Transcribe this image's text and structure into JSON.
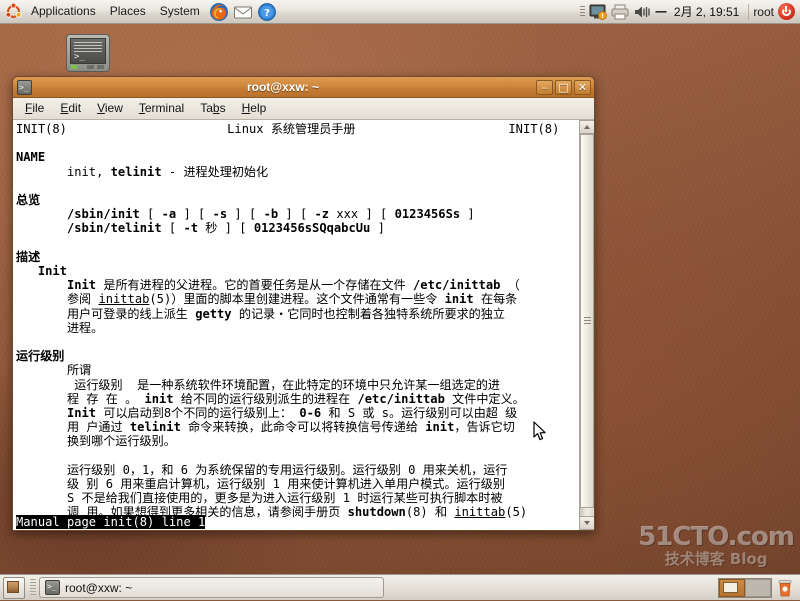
{
  "top_panel": {
    "logo_icon": "ubuntu-logo-icon",
    "menus": [
      {
        "label": "Applications"
      },
      {
        "label": "Places"
      },
      {
        "label": "System"
      }
    ],
    "launchers": [
      {
        "icon": "firefox-icon",
        "title": "Firefox Web Browser"
      },
      {
        "icon": "mail-icon",
        "title": "Evolution Mail"
      },
      {
        "icon": "help-icon",
        "title": "Help"
      }
    ],
    "tray": [
      {
        "icon": "panel-grip-icon"
      },
      {
        "icon": "network-monitor-icon"
      },
      {
        "icon": "printer-icon"
      },
      {
        "icon": "volume-icon"
      },
      {
        "icon": "input-method-icon",
        "label": "—"
      }
    ],
    "clock": "2月 2, 19:51",
    "user": "root",
    "power_icon": "power-icon"
  },
  "desktop": {
    "icons": [
      {
        "icon": "terminal-icon",
        "label": ""
      }
    ],
    "watermark_main": "51CTO.com",
    "watermark_sub": "技术博客  Blog"
  },
  "terminal_window": {
    "title": "root@xxw: ~",
    "title_icon": "terminal-icon",
    "window_buttons": [
      {
        "name": "minimize",
        "glyph": "–"
      },
      {
        "name": "maximize",
        "glyph": "□"
      },
      {
        "name": "close",
        "glyph": "✕"
      }
    ],
    "menus": [
      {
        "label": "File",
        "mnemonic": "F"
      },
      {
        "label": "Edit",
        "mnemonic": "E"
      },
      {
        "label": "View",
        "mnemonic": "V"
      },
      {
        "label": "Terminal",
        "mnemonic": "T"
      },
      {
        "label": "Tabs",
        "mnemonic": "b"
      },
      {
        "label": "Help",
        "mnemonic": "H"
      }
    ],
    "content": {
      "header_left": "INIT(8)",
      "header_center": "Linux 系统管理员手册",
      "header_right": "INIT(8)",
      "sections": [
        {
          "heading": "NAME",
          "lines": [
            "       init, telinit - 进程处理初始化"
          ]
        },
        {
          "heading": "总览",
          "lines": [
            "       /sbin/init [ -a ] [ -s ] [ -b ] [ -z xxx ] [ 0123456Ss ]",
            "       /sbin/telinit [ -t 秒 ] [ 0123456sSQqabcUu ]"
          ]
        },
        {
          "heading": "描述",
          "lines": [
            "   Init",
            "       Init 是所有进程的父进程。它的首要任务是从一个存储在文件 /etc/inittab （",
            "       参阅 inittab(5)）里面的脚本里创建进程。这个文件通常有一些令 init 在每条",
            "       用户可登录的线上派生 getty 的记录・它同时也控制着各独特系统所要求的独立",
            "       进程。"
          ]
        },
        {
          "heading": "运行级别",
          "lines": [
            "       所谓",
            "        运行级别  是一种系统软件环境配置，在此特定的环境中只允许某一组选定的进",
            "       程 存 在 。 init 给不同的运行级别派生的进程在 /etc/inittab 文件中定义。",
            "       Init 可以启动到8个不同的运行级别上： 0-6 和 S 或 s。运行级别可以由超 级",
            "       用 户通过 telinit 命令来转换，此命令可以将转换信号传递给 init，告诉它切",
            "       换到哪个运行级别。",
            "",
            "       运行级别 0，1，和 6 为系统保留的专用运行级别。运行级别 0 用来关机，运行",
            "       级 别 6 用来重启计算机，运行级别 1 用来使计算机进入单用户模式。运行级别",
            "       S 不是给我们直接使用的，更多是为进入运行级别 1 时运行某些可执行脚本时被",
            "       调 用。如果想得到更多相关的信息，请参阅手册页 shutdown(8) 和 inittab(5)"
          ]
        }
      ],
      "status_line": "Manual page init(8) line 1"
    },
    "scrollbar": {
      "up_icon": "scroll-up-icon",
      "down_icon": "scroll-down-icon",
      "thumb_position_percent": 0
    }
  },
  "bottom_panel": {
    "show_desktop_icon": "show-desktop-icon",
    "tasks": [
      {
        "label": "root@xxw: ~",
        "icon": "terminal-icon",
        "active": true
      }
    ],
    "workspaces": [
      {
        "name": "workspace-1",
        "active": true
      },
      {
        "name": "workspace-2",
        "active": false
      }
    ],
    "trash_icon": "trash-icon"
  },
  "colors": {
    "panel_bg": "#e5e1d9",
    "titlebar_orange": "#c47c34",
    "desktop_brown": "#8a5135",
    "terminal_bg": "#ffffff",
    "terminal_fg": "#000000"
  }
}
